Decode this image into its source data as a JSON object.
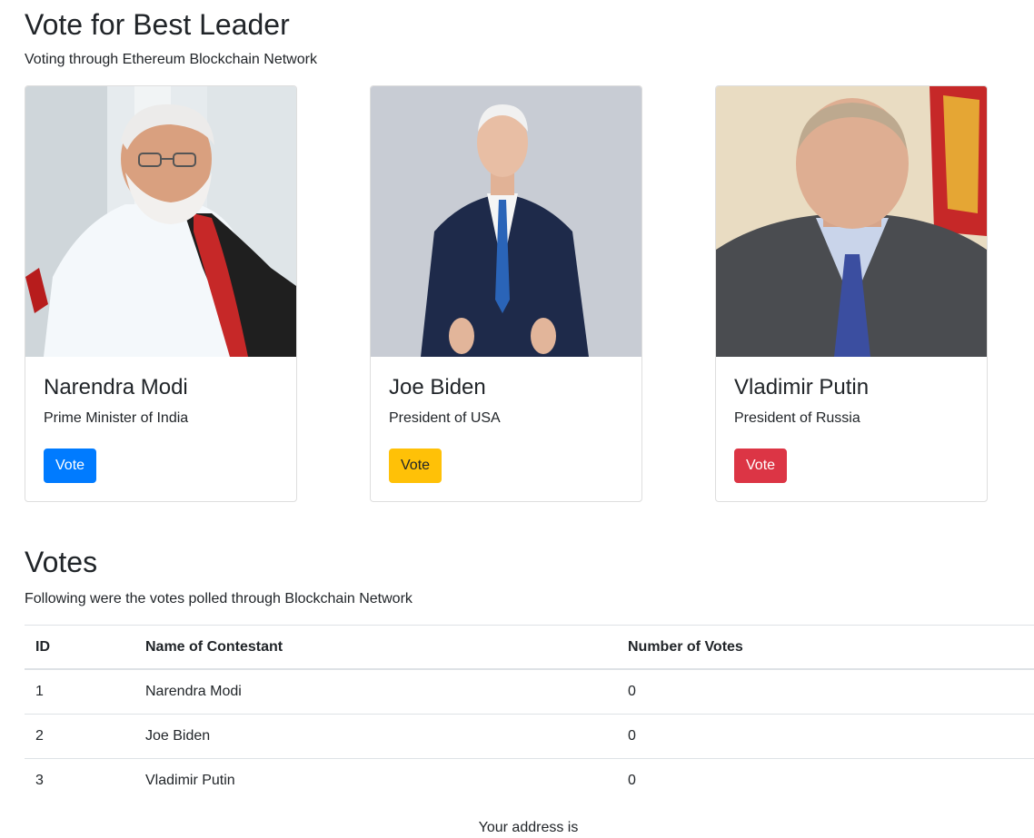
{
  "header": {
    "title": "Vote for Best Leader",
    "subtitle": "Voting through Ethereum Blockchain Network"
  },
  "candidates": [
    {
      "name": "Narendra Modi",
      "role": "Prime Minister of India",
      "vote_label": "Vote",
      "button_color": "#007bff"
    },
    {
      "name": "Joe Biden",
      "role": "President of USA",
      "vote_label": "Vote",
      "button_color": "#ffc107"
    },
    {
      "name": "Vladimir Putin",
      "role": "President of Russia",
      "vote_label": "Vote",
      "button_color": "#dc3545"
    }
  ],
  "votes": {
    "title": "Votes",
    "subtitle": "Following were the votes polled through Blockchain Network",
    "columns": [
      "ID",
      "Name of Contestant",
      "Number of Votes"
    ],
    "rows": [
      [
        "1",
        "Narendra Modi",
        "0"
      ],
      [
        "2",
        "Joe Biden",
        "0"
      ],
      [
        "3",
        "Vladimir Putin",
        "0"
      ]
    ]
  },
  "footer": {
    "address_label": "Your address is"
  }
}
